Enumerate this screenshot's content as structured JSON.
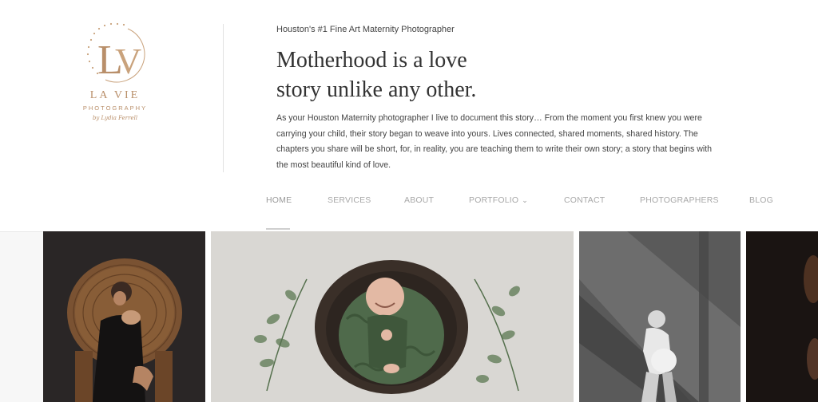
{
  "brand": {
    "monogram": "LV",
    "name": "LA VIE",
    "sub": "PHOTOGRAPHY",
    "signature": "by Lydia Ferrell",
    "color": "#b98f6a"
  },
  "header": {
    "tagline": "Houston's #1 Fine Art Maternity Photographer",
    "headline_line1": "Motherhood is a love",
    "headline_line2": "story unlike any other.",
    "intro": "As your Houston Maternity photographer I live to document this story… From the moment you first knew you were carrying your child, their story began to weave into yours. Lives connected, shared moments, shared history. The chapters you share will be short, for, in reality, you are teaching them to write their own story; a story that begins with the most beautiful kind of love."
  },
  "nav": {
    "items": [
      {
        "label": "HOME",
        "active": true
      },
      {
        "label": "SERVICES"
      },
      {
        "label": "ABOUT"
      },
      {
        "label": "PORTFOLIO",
        "icon": "chevron-down-icon"
      },
      {
        "label": "CONTACT"
      },
      {
        "label": "PHOTOGRAPHERS"
      },
      {
        "label": "BLOG"
      }
    ]
  },
  "gallery": {
    "images": [
      {
        "name": "mother-in-wicker-chair-photo"
      },
      {
        "name": "newborn-in-bowl-photo"
      },
      {
        "name": "maternity-window-light-photo"
      },
      {
        "name": "dark-maternity-photo-partial"
      }
    ]
  }
}
